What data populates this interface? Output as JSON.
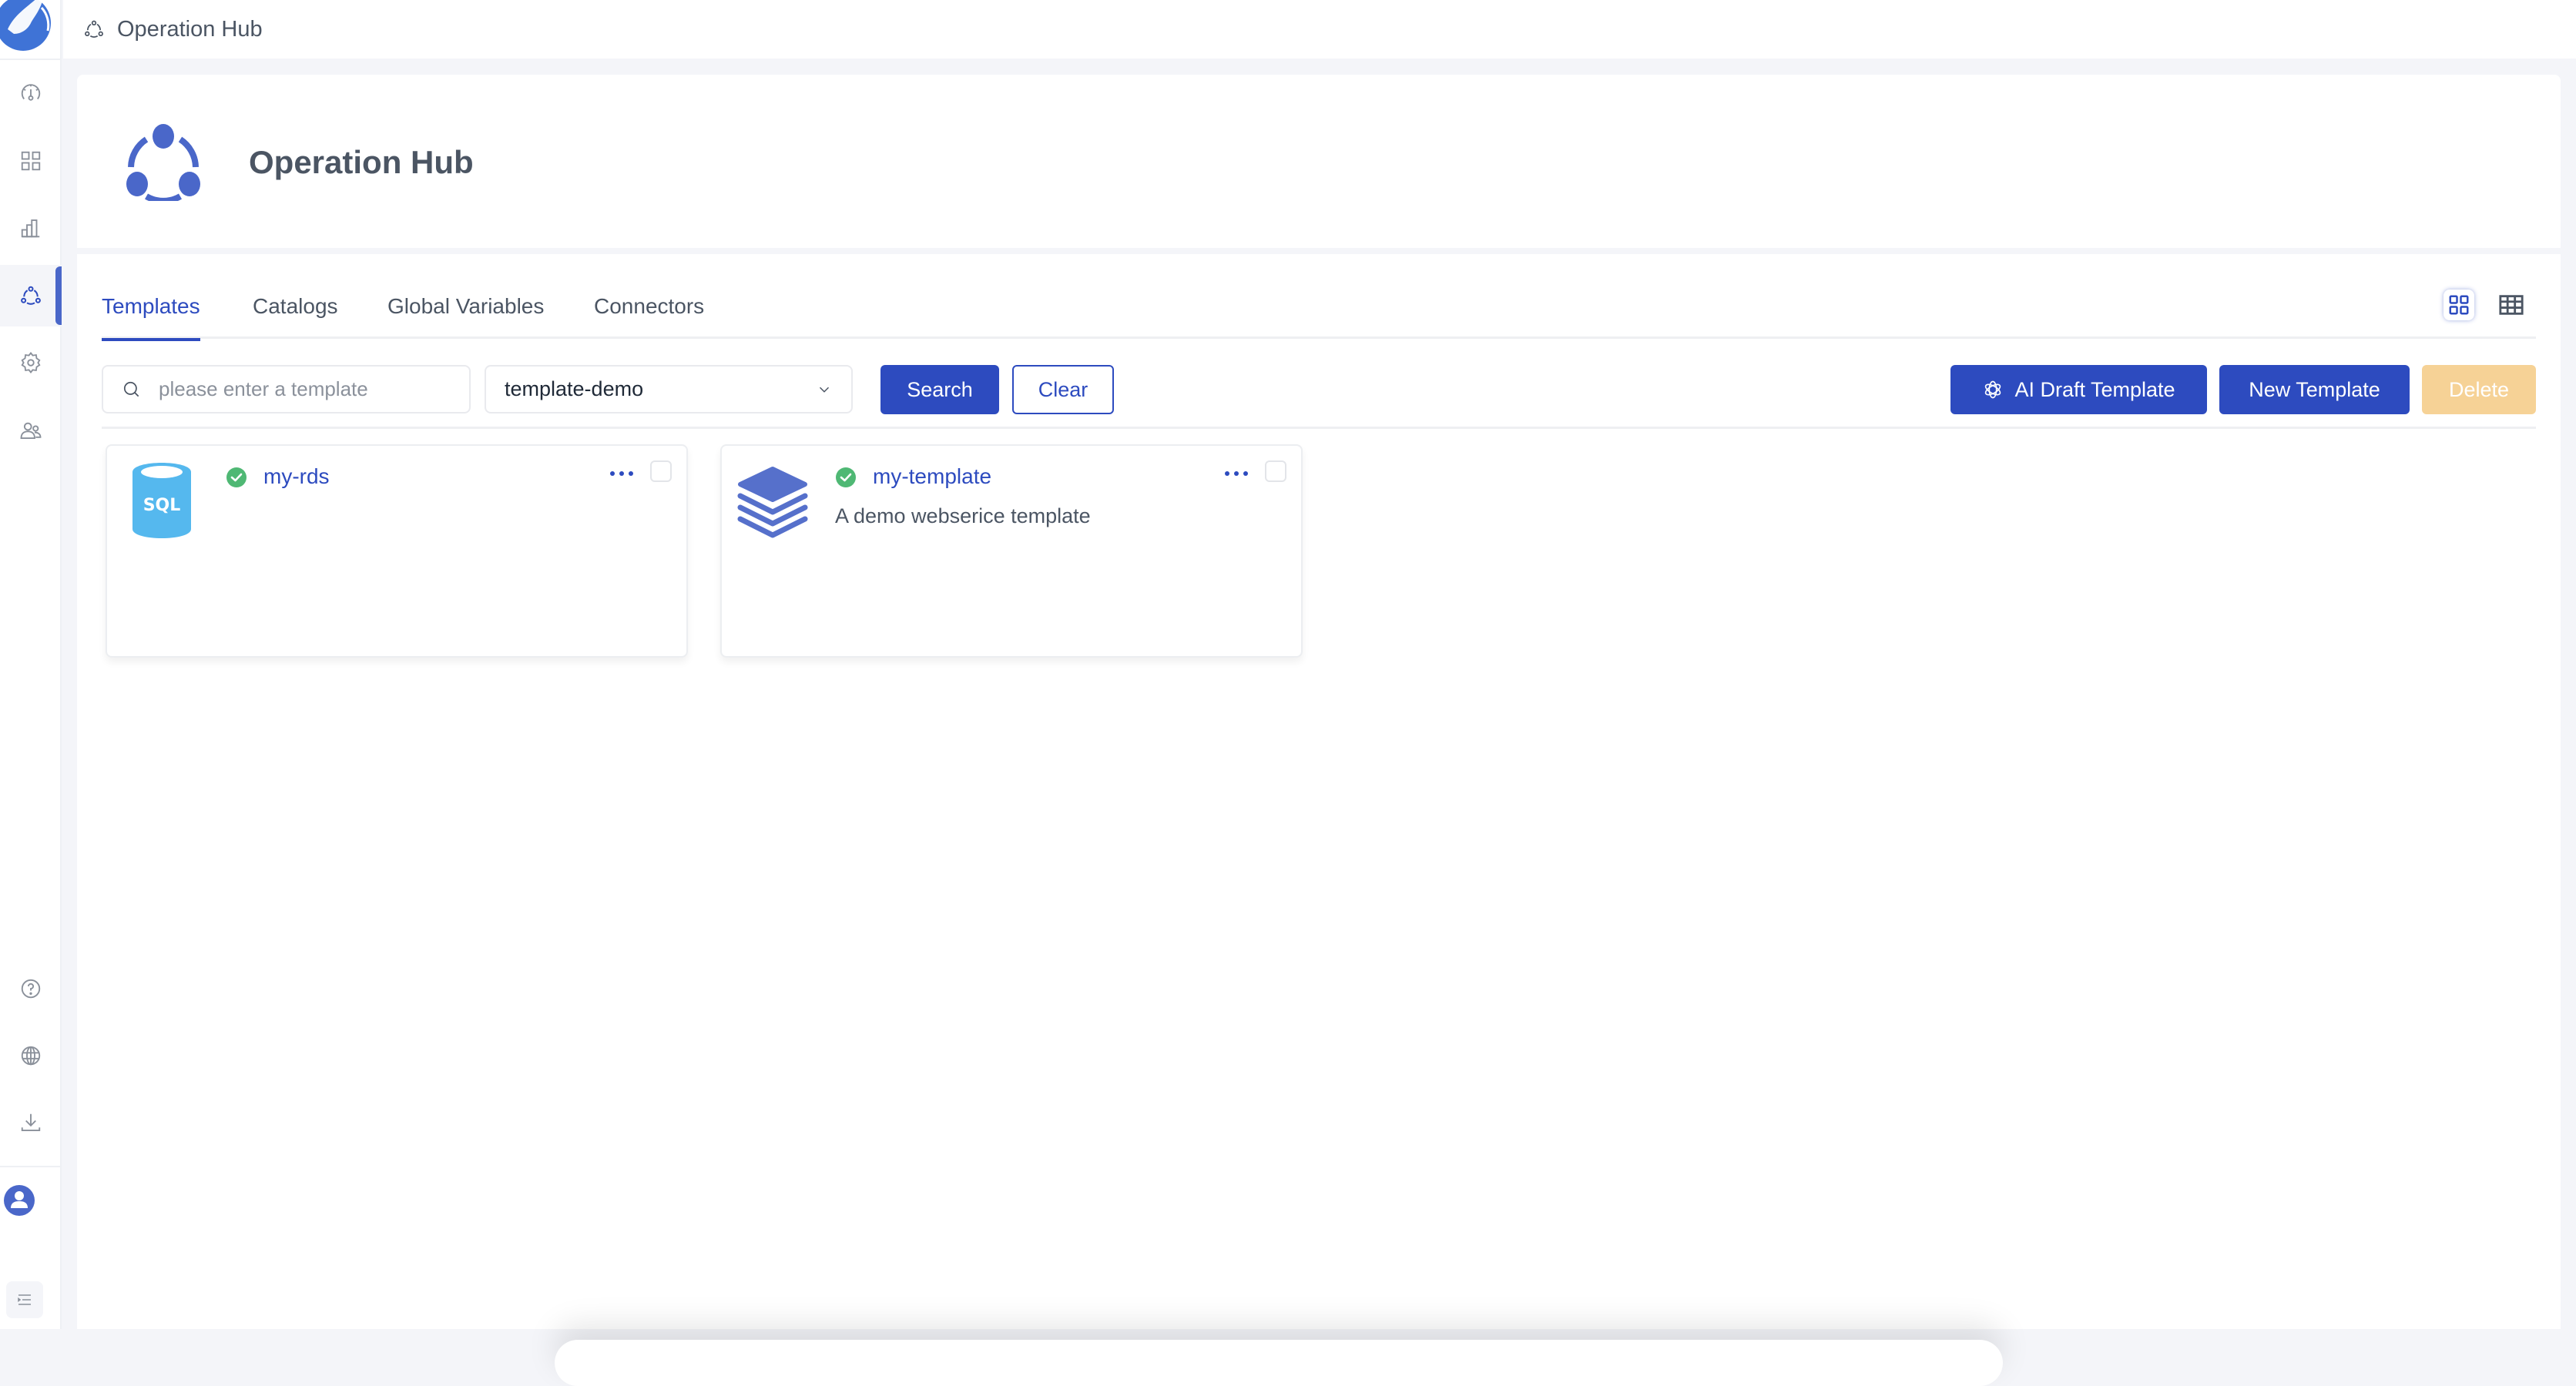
{
  "app": {
    "breadcrumb": "Operation Hub",
    "page_title": "Operation Hub",
    "accent_color": "#2d4bbf"
  },
  "sidebar": {
    "items": [
      {
        "name": "dashboard",
        "icon": "gauge-icon",
        "active": false
      },
      {
        "name": "apps",
        "icon": "grid-icon",
        "active": false
      },
      {
        "name": "analytics",
        "icon": "bar-chart-icon",
        "active": false
      },
      {
        "name": "operation-hub",
        "icon": "hub-icon",
        "active": true
      },
      {
        "name": "settings",
        "icon": "gear-icon",
        "active": false
      },
      {
        "name": "users",
        "icon": "users-icon",
        "active": false
      }
    ],
    "bottom_items": [
      {
        "name": "help",
        "icon": "help-icon"
      },
      {
        "name": "language",
        "icon": "globe-icon"
      },
      {
        "name": "download",
        "icon": "download-icon"
      }
    ]
  },
  "tabs": [
    {
      "label": "Templates",
      "active": true
    },
    {
      "label": "Catalogs",
      "active": false
    },
    {
      "label": "Global Variables",
      "active": false
    },
    {
      "label": "Connectors",
      "active": false
    }
  ],
  "view_modes": [
    {
      "name": "card-view",
      "active": true
    },
    {
      "name": "table-view",
      "active": false
    }
  ],
  "filters": {
    "search_placeholder": "please enter a template",
    "search_value": "",
    "catalog_selected": "template-demo"
  },
  "buttons": {
    "search": "Search",
    "clear": "Clear",
    "ai_draft": "AI Draft Template",
    "new_template": "New Template",
    "delete": "Delete"
  },
  "templates": [
    {
      "name": "my-rds",
      "description": "",
      "icon": "sql-database-icon",
      "status": "success",
      "checked": false
    },
    {
      "name": "my-template",
      "description": "A demo webserice template",
      "icon": "layers-icon",
      "status": "success",
      "checked": false
    }
  ]
}
